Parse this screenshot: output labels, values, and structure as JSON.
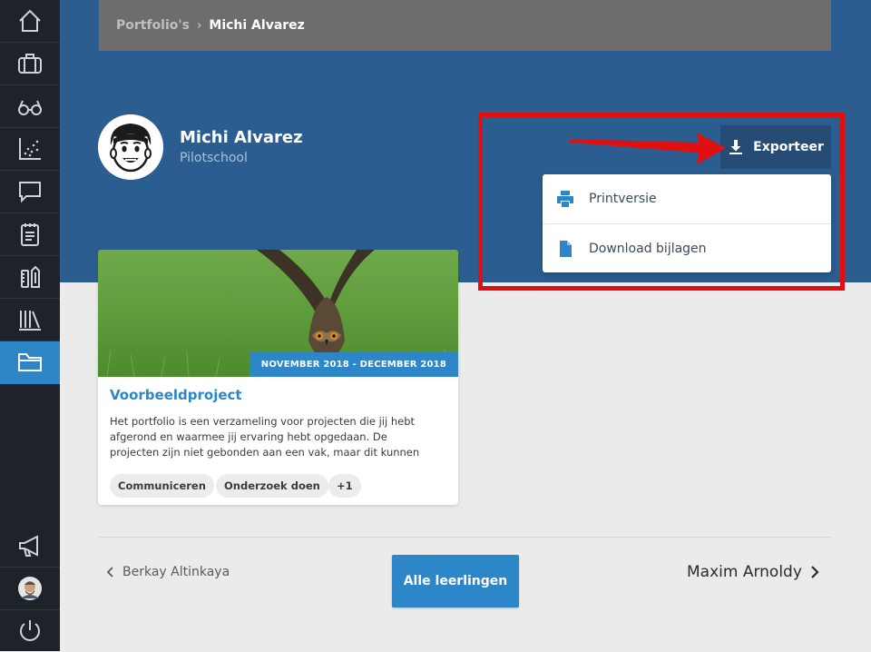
{
  "breadcrumb": {
    "parent": "Portfolio's",
    "separator": "›",
    "current": "Michi Alvarez"
  },
  "student": {
    "name": "Michi Alvarez",
    "school": "Pilotschool"
  },
  "export": {
    "label": "Exporteer"
  },
  "export_menu": [
    {
      "label": "Printversie",
      "icon": "printer-icon"
    },
    {
      "label": "Download bijlagen",
      "icon": "file-icon"
    }
  ],
  "project": {
    "date_range": "NOVEMBER 2018 - DECEMBER 2018",
    "title": "Voorbeeldproject",
    "description": "Het portfolio is een verzameling voor projecten die jij hebt afgerond en waarmee jij ervaring hebt opgedaan. De projecten zijn niet gebonden aan een vak, maar dit kunnen bijvoorbeeld",
    "tags": [
      "Communiceren",
      "Onderzoek doen",
      "+1"
    ]
  },
  "navigation": {
    "previous": "Berkay Altinkaya",
    "all_students": "Alle leerlingen",
    "next": "Maxim Arnoldy"
  },
  "sidebar": {
    "items": [
      "home-icon",
      "briefcase-icon",
      "glasses-icon",
      "chart-icon",
      "chat-icon",
      "notepad-icon",
      "tools-icon",
      "library-icon",
      "folder-icon"
    ],
    "active": "folder-icon",
    "bottom_items": [
      "megaphone-icon",
      "user-avatar",
      "power-icon"
    ]
  },
  "colors": {
    "accent": "#2d86c8",
    "header_band": "#2c5d90",
    "sidebar": "#1e2329",
    "highlight": "#e01010"
  }
}
